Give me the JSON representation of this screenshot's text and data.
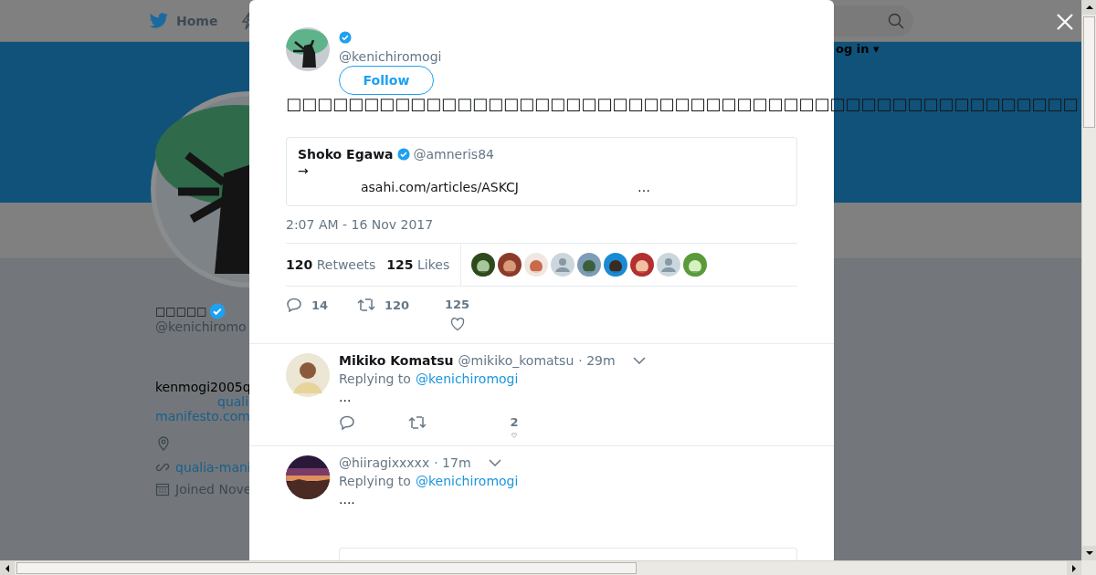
{
  "nav": {
    "home": "Home",
    "login": "og in ▾"
  },
  "profile": {
    "name": "□□□□□",
    "handle": "@kenichiromo",
    "bio": "kenmogi2005q",
    "bio_link_1": "quali",
    "bio_link_2": "manifesto.com",
    "website": "qualia-mani",
    "joined": "Joined Nove"
  },
  "modal": {
    "handle": "@kenichiromogi",
    "follow": "Follow",
    "text": "□□□□□□□□□□□□□□□□□□□□□□□□□□□□□□□□□□□□□□□□□□□□□□□□□□□",
    "quote": {
      "name": "Shoko Egawa",
      "handle": "@amneris84",
      "line_1": "→",
      "url": "asahi.com/articles/ASKCJ",
      "ellipsis": "…"
    },
    "time": "2:07 AM - 16 Nov 2017",
    "retweets": {
      "count": "120",
      "label": "Retweets"
    },
    "likes": {
      "count": "125",
      "label": "Likes"
    },
    "likers": [
      {
        "kind": "picture"
      },
      {
        "kind": "picture"
      },
      {
        "kind": "picture"
      },
      {
        "kind": "default"
      },
      {
        "kind": "picture"
      },
      {
        "kind": "picture"
      },
      {
        "kind": "picture"
      },
      {
        "kind": "default"
      },
      {
        "kind": "picture"
      }
    ],
    "actions": {
      "replies": "14",
      "retweets": "120",
      "likes": "125"
    }
  },
  "replies": [
    {
      "kind": "person",
      "name": "Mikiko Komatsu",
      "handle": "@mikiko_komatsu",
      "time": "· 29m",
      "replying_label": "Replying to",
      "replying_to": "@kenichiromogi",
      "text": "...",
      "likes": "2"
    },
    {
      "kind": "picture",
      "handle": "@hiiragixxxxx",
      "time": "· 17m",
      "replying_label": "Replying to",
      "replying_to": "@kenichiromogi",
      "text": "...."
    }
  ]
}
